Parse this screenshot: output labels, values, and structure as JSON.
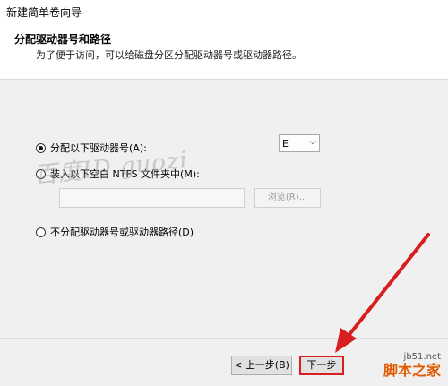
{
  "window": {
    "title": "新建简单卷向导"
  },
  "header": {
    "title": "分配驱动器号和路径",
    "subtitle": "为了便于访问，可以给磁盘分区分配驱动器号或驱动器路径。"
  },
  "options": {
    "assign_letter": {
      "label": "分配以下驱动器号(A):",
      "selected": true
    },
    "drive_letter": {
      "value": "E"
    },
    "mount_folder": {
      "label": "装入以下空白 NTFS 文件夹中(M):",
      "selected": false
    },
    "folder_path": {
      "value": ""
    },
    "browse_button": {
      "label": "浏览(R)..."
    },
    "no_assign": {
      "label": "不分配驱动器号或驱动器路径(D)",
      "selected": false
    }
  },
  "footer": {
    "prev_button": "< 上一步(B)",
    "next_button": "下一步"
  },
  "watermark": {
    "text": "百度ID  guozi"
  },
  "site_logo": {
    "domain": "jb51.net",
    "name": "脚本之家"
  },
  "colors": {
    "highlight": "#d81e1e",
    "arrow": "#d81e1e"
  }
}
